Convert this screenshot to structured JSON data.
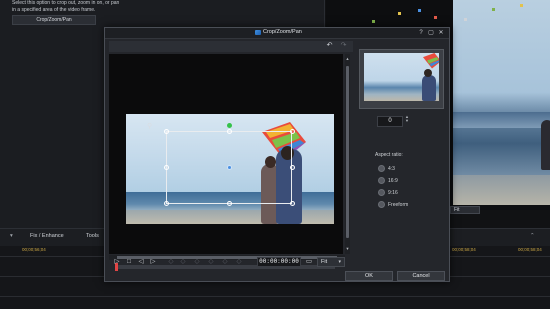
{
  "background_app": {
    "description": "Select this option to crop out, zoom in on, or pan in a specified area of the video frame.",
    "crop_button_label": "Crop/Zoom/Pan",
    "tabs": [
      "Fix / Enhance",
      "Tools"
    ],
    "fit_label": "Fit",
    "timecodes": [
      "00;00;56;04",
      "00;00;58;04",
      "00;00;58;04",
      "00;00;59;04"
    ]
  },
  "dialog": {
    "title": "Crop/Zoom/Pan",
    "help_label": "?",
    "controls": {
      "timecode": "00:00:00:00",
      "fit_value": "Fit"
    },
    "side": {
      "rotation_value": "0",
      "aspect_ratio_label": "Aspect ratio:",
      "aspect_options": [
        "4:3",
        "16:9",
        "9:16",
        "Freeform"
      ]
    },
    "ok_label": "OK",
    "cancel_label": "Cancel"
  },
  "colors": {
    "accent": "#4a90e2",
    "rotate_handle": "#35c24a",
    "playhead": "#e04545",
    "timecode_text": "#c9a544"
  },
  "icons": [
    "crop-icon",
    "undo-icon",
    "redo-icon",
    "play-icon",
    "stop-icon",
    "prev-frame-icon",
    "next-frame-icon",
    "keyframe-icon",
    "monitor-icon",
    "link-icon",
    "chevron-down-icon"
  ]
}
